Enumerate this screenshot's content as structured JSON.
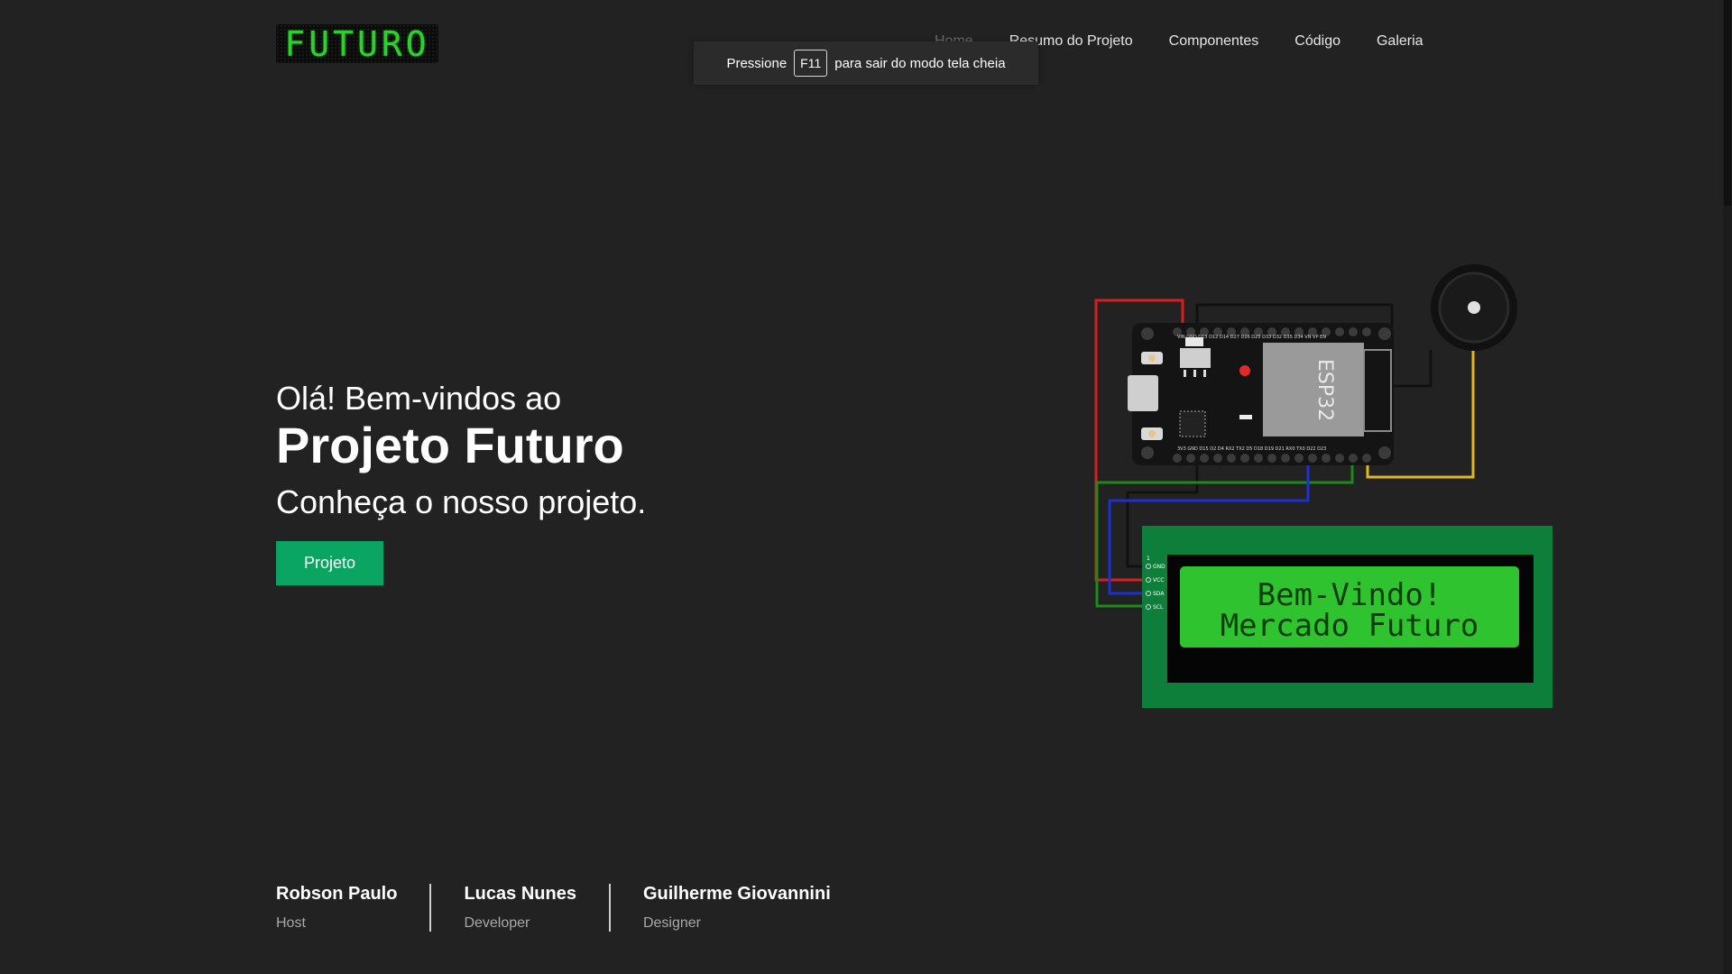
{
  "logo": {
    "text": "FUTURO"
  },
  "nav": [
    "Home",
    "Resumo do Projeto",
    "Componentes",
    "Código",
    "Galeria"
  ],
  "fullscreen_notice": {
    "before": "Pressione",
    "key": "F11",
    "after": "para sair do modo tela cheia"
  },
  "hero": {
    "greeting": "Olá! Bem-vindos ao",
    "title": "Projeto Futuro",
    "subtitle": "Conheça o nosso projeto.",
    "button": "Projeto"
  },
  "diagram": {
    "esp_label": "ESP32",
    "lcd_line1": "Bem-Vindo!",
    "lcd_line2": "Mercado Futuro",
    "lcd_pins": [
      "GND",
      "VCC",
      "SDA",
      "SCL"
    ],
    "lcd_pin_number": "1",
    "esp_top_pins": "VIN GND D13 D12 D14 D27 D26 D25 D33 D32 D35 D34 VN VP EN",
    "esp_bottom_pins": "3V3 GND D15 D2 D4 RX2 TX2 D5 D18 D19 D21 RX0 TX0 D22 D23"
  },
  "team": [
    {
      "name": "Robson Paulo",
      "role": "Host"
    },
    {
      "name": "Lucas Nunes",
      "role": "Developer"
    },
    {
      "name": "Guilherme Giovannini",
      "role": "Designer"
    }
  ]
}
